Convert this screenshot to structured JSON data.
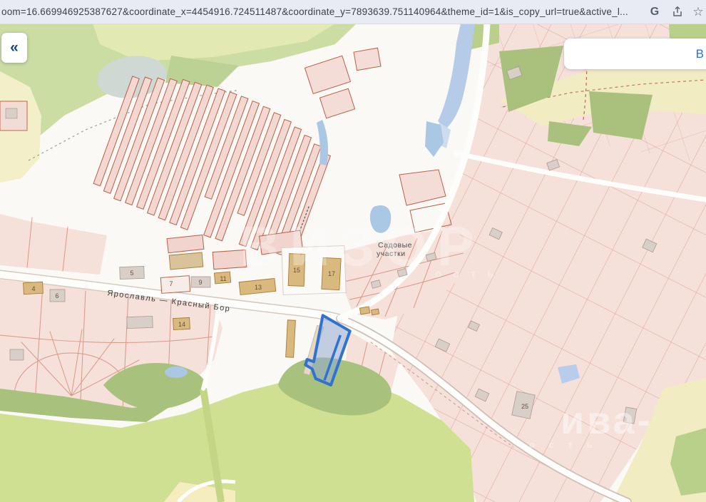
{
  "browser": {
    "url": "oom=16.669946925387627&coordinate_x=4454916.724511487&coordinate_y=7893639.751140964&theme_id=1&is_copy_url=true&active_l...",
    "google_letter": "G",
    "bookmark_star": "☆"
  },
  "map": {
    "collapse_button": "«",
    "search_panel_text": "В",
    "road_label": "Ярославль — Красный Бор",
    "area_label_line1": "Садовые",
    "area_label_line2": "участки",
    "building_numbers": {
      "b4": "4",
      "b6": "6",
      "b5": "5",
      "b7": "7",
      "b9": "9",
      "b11": "11",
      "b13": "13",
      "b14": "14",
      "b15": "15",
      "b17": "17",
      "b25": "25"
    },
    "watermark": {
      "center_big": "ВИЗОР",
      "center_small": "о с т ь",
      "corner_big": "ива-",
      "corner_small": "о с т ь"
    },
    "colors": {
      "selected_parcel_stroke": "#2f72cf",
      "selected_parcel_fill": "#93a9cf",
      "parcel_outline": "#c2654f",
      "parcel_fill": "#f6e0da",
      "water": "#aac7e4",
      "forest": "#a9c17c",
      "field": "#cfe093",
      "sand": "#f1ecc2"
    }
  }
}
